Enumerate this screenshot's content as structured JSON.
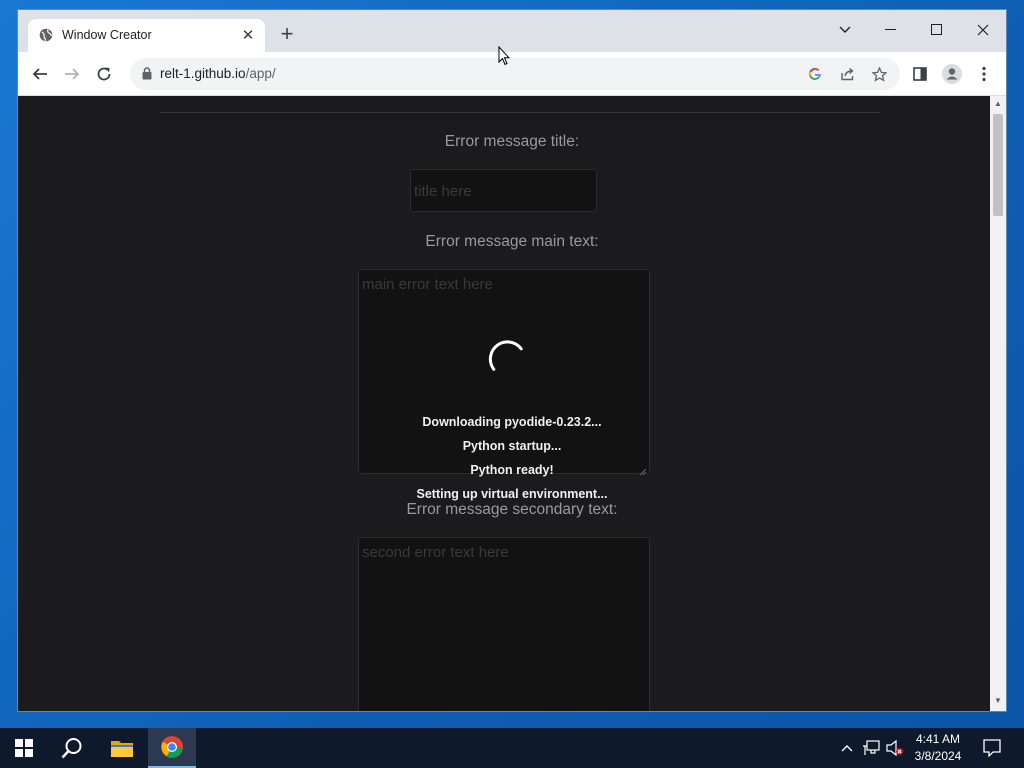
{
  "browser": {
    "tab_title": "Window Creator",
    "url_host": "relt-1.github.io",
    "url_path": "/app/"
  },
  "form": {
    "title_label": "Error message title:",
    "title_placeholder": "title here",
    "main_label": "Error message main text:",
    "main_placeholder": "main error text here",
    "secondary_label": "Error message secondary text:",
    "secondary_placeholder": "second error text here"
  },
  "loading": {
    "lines": [
      "Downloading pyodide-0.23.2...",
      "Python startup...",
      "Python ready!",
      "Setting up virtual environment..."
    ]
  },
  "taskbar": {
    "time": "4:41 AM",
    "date": "3/8/2024"
  },
  "colors": {
    "page_bg": "#1b1b1d",
    "label_text": "#9a9a9c",
    "field_bg": "#121213",
    "accent_taskbar": "#76b9ed"
  },
  "icons": {
    "tab_favicon": "globe-icon",
    "toolbar": [
      "back-icon",
      "forward-icon",
      "reload-icon",
      "lock-icon",
      "google-icon",
      "share-icon",
      "star-icon",
      "side-panel-icon",
      "profile-icon",
      "menu-icon"
    ],
    "tray": [
      "chevron-up-icon",
      "network-icon",
      "volume-muted-icon",
      "notification-icon"
    ]
  }
}
